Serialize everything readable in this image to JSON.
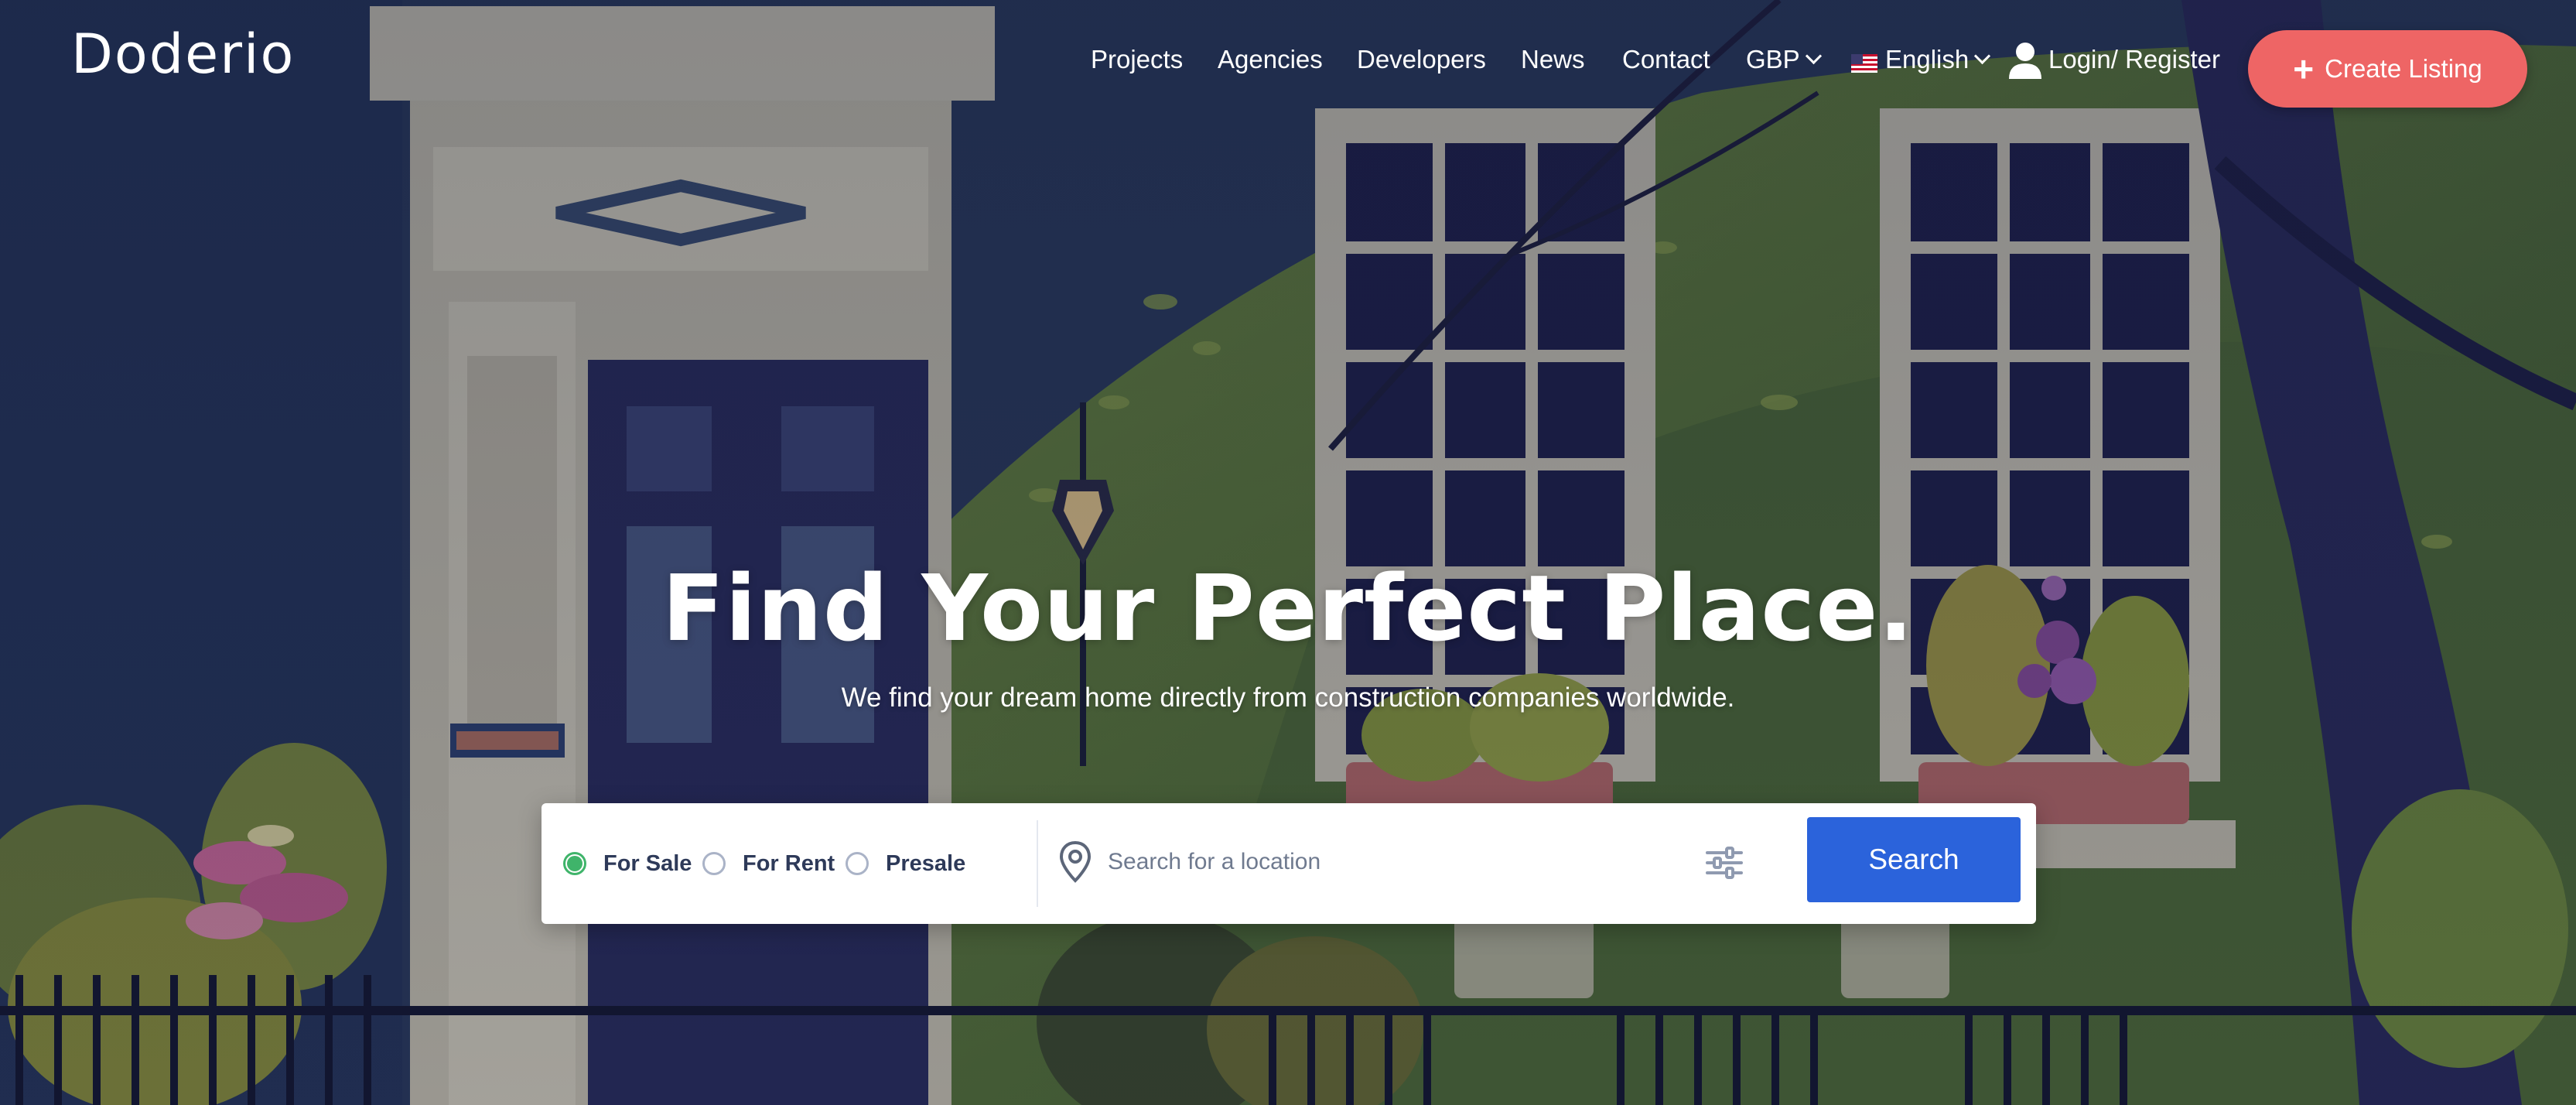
{
  "brand": {
    "logo": "Doderio",
    "accent": "#ee6565",
    "primary": "#2b63db"
  },
  "nav": {
    "projects": "Projects",
    "agencies": "Agencies",
    "developers": "Developers",
    "news": "News",
    "contact": "Contact",
    "currency": "GBP",
    "language": "English",
    "login": "Login/ Register",
    "create_listing": "Create Listing",
    "icons": {
      "flag": "us-flag-icon",
      "user": "user-icon",
      "plus": "plus-icon",
      "chevron": "chevron-down-icon"
    }
  },
  "hero": {
    "title": "Find Your Perfect Place.",
    "subtitle": "We find your dream home directly from construction companies worldwide."
  },
  "search": {
    "options": [
      {
        "label": "For Sale",
        "checked": true
      },
      {
        "label": "For Rent",
        "checked": false
      },
      {
        "label": "Presale",
        "checked": false
      }
    ],
    "placeholder": "Search for a location",
    "button": "Search",
    "icons": {
      "location": "location-pin-icon",
      "filters": "filter-sliders-icon"
    }
  }
}
